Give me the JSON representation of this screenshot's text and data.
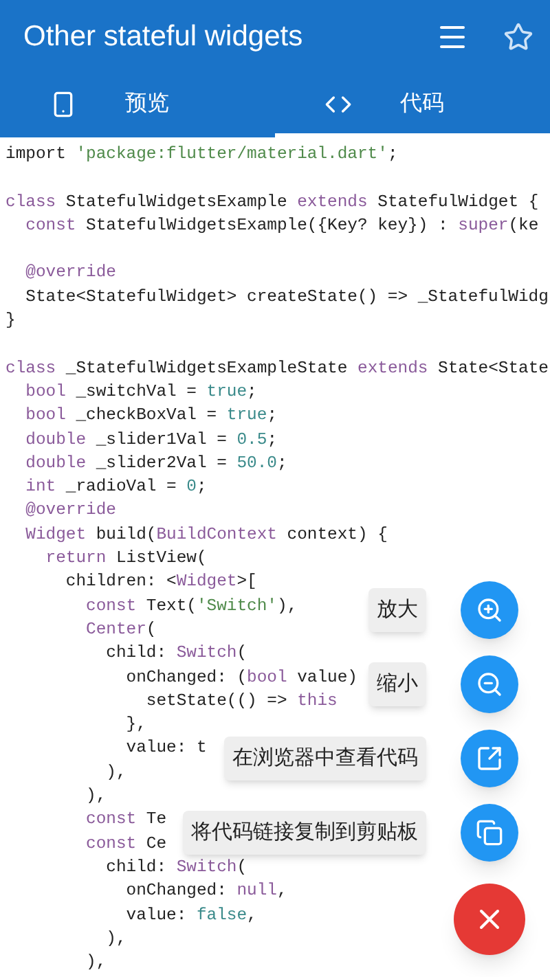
{
  "app_bar": {
    "title": "Other stateful widgets"
  },
  "tabs": [
    {
      "label": "预览",
      "kind": "phone",
      "selected": false
    },
    {
      "label": "代码",
      "kind": "code",
      "selected": true
    }
  ],
  "code_lines": [
    {
      "kind": "code",
      "tokens": [
        {
          "text": "import ",
          "kind": "plain"
        },
        {
          "text": "'package:flutter/material.dart'",
          "kind": "string"
        },
        {
          "text": ";",
          "kind": "plain"
        }
      ]
    },
    {
      "kind": "blank"
    },
    {
      "kind": "code",
      "tokens": [
        {
          "text": "class ",
          "kind": "keyword"
        },
        {
          "text": "StatefulWidgetsExample ",
          "kind": "plain"
        },
        {
          "text": "extends ",
          "kind": "keyword"
        },
        {
          "text": "StatefulWidget {",
          "kind": "plain"
        }
      ]
    },
    {
      "kind": "code",
      "tokens": [
        {
          "text": "  const ",
          "kind": "keyword"
        },
        {
          "text": "StatefulWidgetsExample({Key? key}) : ",
          "kind": "plain"
        },
        {
          "text": "super",
          "kind": "keyword"
        },
        {
          "text": "(ke",
          "kind": "plain"
        }
      ]
    },
    {
      "kind": "blank"
    },
    {
      "kind": "code",
      "tokens": [
        {
          "text": "  @override",
          "kind": "keyword"
        }
      ]
    },
    {
      "kind": "code",
      "tokens": [
        {
          "text": "  State<StatefulWidget> createState() => _StatefulWidg",
          "kind": "plain"
        }
      ]
    },
    {
      "kind": "code",
      "tokens": [
        {
          "text": "}",
          "kind": "plain"
        }
      ]
    },
    {
      "kind": "blank"
    },
    {
      "kind": "code",
      "tokens": [
        {
          "text": "class ",
          "kind": "keyword"
        },
        {
          "text": "_StatefulWidgetsExampleState ",
          "kind": "plain"
        },
        {
          "text": "extends ",
          "kind": "keyword"
        },
        {
          "text": "State<State",
          "kind": "plain"
        }
      ]
    },
    {
      "kind": "code",
      "tokens": [
        {
          "text": "  bool ",
          "kind": "keyword"
        },
        {
          "text": "_switchVal = ",
          "kind": "plain"
        },
        {
          "text": "true",
          "kind": "number"
        },
        {
          "text": ";",
          "kind": "plain"
        }
      ]
    },
    {
      "kind": "code",
      "tokens": [
        {
          "text": "  bool ",
          "kind": "keyword"
        },
        {
          "text": "_checkBoxVal = ",
          "kind": "plain"
        },
        {
          "text": "true",
          "kind": "number"
        },
        {
          "text": ";",
          "kind": "plain"
        }
      ]
    },
    {
      "kind": "code",
      "tokens": [
        {
          "text": "  double ",
          "kind": "keyword"
        },
        {
          "text": "_slider1Val = ",
          "kind": "plain"
        },
        {
          "text": "0.5",
          "kind": "number"
        },
        {
          "text": ";",
          "kind": "plain"
        }
      ]
    },
    {
      "kind": "code",
      "tokens": [
        {
          "text": "  double ",
          "kind": "keyword"
        },
        {
          "text": "_slider2Val = ",
          "kind": "plain"
        },
        {
          "text": "50.0",
          "kind": "number"
        },
        {
          "text": ";",
          "kind": "plain"
        }
      ]
    },
    {
      "kind": "code",
      "tokens": [
        {
          "text": "  int ",
          "kind": "keyword"
        },
        {
          "text": "_radioVal = ",
          "kind": "plain"
        },
        {
          "text": "0",
          "kind": "number"
        },
        {
          "text": ";",
          "kind": "plain"
        }
      ]
    },
    {
      "kind": "code",
      "tokens": [
        {
          "text": "  @override",
          "kind": "keyword"
        }
      ]
    },
    {
      "kind": "code",
      "tokens": [
        {
          "text": "  Widget ",
          "kind": "keyword"
        },
        {
          "text": "build(",
          "kind": "plain"
        },
        {
          "text": "BuildContext ",
          "kind": "keyword"
        },
        {
          "text": "context) {",
          "kind": "plain"
        }
      ]
    },
    {
      "kind": "code",
      "tokens": [
        {
          "text": "    return ",
          "kind": "keyword"
        },
        {
          "text": "ListView(",
          "kind": "plain"
        }
      ]
    },
    {
      "kind": "code",
      "tokens": [
        {
          "text": "      children: <",
          "kind": "plain"
        },
        {
          "text": "Widget",
          "kind": "keyword"
        },
        {
          "text": ">[",
          "kind": "plain"
        }
      ]
    },
    {
      "kind": "code",
      "tokens": [
        {
          "text": "        const ",
          "kind": "keyword"
        },
        {
          "text": "Text(",
          "kind": "plain"
        },
        {
          "text": "'Switch'",
          "kind": "string"
        },
        {
          "text": "),",
          "kind": "plain"
        }
      ]
    },
    {
      "kind": "code",
      "tokens": [
        {
          "text": "        Center",
          "kind": "keyword"
        },
        {
          "text": "(",
          "kind": "plain"
        }
      ]
    },
    {
      "kind": "code",
      "tokens": [
        {
          "text": "          child: ",
          "kind": "plain"
        },
        {
          "text": "Switch",
          "kind": "keyword"
        },
        {
          "text": "(",
          "kind": "plain"
        }
      ]
    },
    {
      "kind": "code",
      "tokens": [
        {
          "text": "            onChanged: (",
          "kind": "plain"
        },
        {
          "text": "bool ",
          "kind": "keyword"
        },
        {
          "text": "value)",
          "kind": "plain"
        }
      ]
    },
    {
      "kind": "code",
      "tokens": [
        {
          "text": "              setState(() => ",
          "kind": "plain"
        },
        {
          "text": "this",
          "kind": "keyword"
        }
      ]
    },
    {
      "kind": "code",
      "tokens": [
        {
          "text": "            },",
          "kind": "plain"
        }
      ]
    },
    {
      "kind": "code",
      "tokens": [
        {
          "text": "            value: t",
          "kind": "plain"
        }
      ]
    },
    {
      "kind": "code",
      "tokens": [
        {
          "text": "          ),",
          "kind": "plain"
        }
      ]
    },
    {
      "kind": "code",
      "tokens": [
        {
          "text": "        ),",
          "kind": "plain"
        }
      ]
    },
    {
      "kind": "code",
      "tokens": [
        {
          "text": "        const ",
          "kind": "keyword"
        },
        {
          "text": "Te",
          "kind": "plain"
        }
      ]
    },
    {
      "kind": "code",
      "tokens": [
        {
          "text": "        const ",
          "kind": "keyword"
        },
        {
          "text": "Ce",
          "kind": "plain"
        }
      ]
    },
    {
      "kind": "code",
      "tokens": [
        {
          "text": "          child: ",
          "kind": "plain"
        },
        {
          "text": "Switch",
          "kind": "keyword"
        },
        {
          "text": "(",
          "kind": "plain"
        }
      ]
    },
    {
      "kind": "code",
      "tokens": [
        {
          "text": "            onChanged: ",
          "kind": "plain"
        },
        {
          "text": "null",
          "kind": "keyword"
        },
        {
          "text": ",",
          "kind": "plain"
        }
      ]
    },
    {
      "kind": "code",
      "tokens": [
        {
          "text": "            value: ",
          "kind": "plain"
        },
        {
          "text": "false",
          "kind": "number"
        },
        {
          "text": ",",
          "kind": "plain"
        }
      ]
    },
    {
      "kind": "code",
      "tokens": [
        {
          "text": "          ),",
          "kind": "plain"
        }
      ]
    },
    {
      "kind": "code",
      "tokens": [
        {
          "text": "        ),",
          "kind": "plain"
        }
      ]
    }
  ],
  "speed_dial": {
    "actions": [
      {
        "label": "放大",
        "kind": "zoom-in"
      },
      {
        "label": "缩小",
        "kind": "zoom-out"
      },
      {
        "label": "在浏览器中查看代码",
        "kind": "open-external"
      },
      {
        "label": "将代码链接复制到剪贴板",
        "kind": "copy"
      }
    ],
    "main_button": {
      "kind": "close"
    }
  }
}
